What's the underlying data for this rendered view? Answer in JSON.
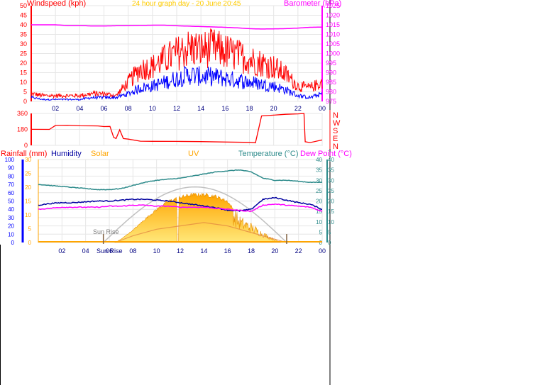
{
  "header": {
    "windspeed_label": "Windspeed (kph)",
    "title": "24 hour graph day - 20 June 20:45",
    "barometer_label": "Barometer (hPa)"
  },
  "bottom_header": {
    "rainfall_label": "Rainfall (mm)",
    "humidity_label": "Humidity",
    "solar_label": "Solar",
    "uv_label": "UV",
    "temperature_label": "Temperature (°C)",
    "dewpoint_label": "Dew Point (°C)"
  },
  "direction_labels": [
    "N",
    "W",
    "S",
    "E",
    "N"
  ],
  "sun_rise_label_top": "Sun Rise",
  "sun_rise_label_bottom": "Sun Rise",
  "colors": {
    "wind_gust": "#ff0000",
    "wind_avg": "#0000ff",
    "barometer": "#ff00ff",
    "direction": "#ff0000",
    "humidity": "#0000a0",
    "solar": "#ffa500",
    "uv_curve": "#c0c0c0",
    "temperature": "#2e8b8b",
    "dewpoint": "#ff00ff",
    "rainfall_axis": "#0000ff"
  },
  "chart_data": [
    {
      "type": "line",
      "name": "wind-barometer",
      "x_ticks": [
        "02",
        "04",
        "06",
        "08",
        "10",
        "12",
        "14",
        "16",
        "18",
        "20",
        "22",
        "00"
      ],
      "left_ticks": [
        "0",
        "5",
        "10",
        "15",
        "20",
        "25",
        "30",
        "35",
        "40",
        "45",
        "50"
      ],
      "right_ticks": [
        "975",
        "980",
        "985",
        "990",
        "995",
        "1000",
        "1005",
        "1010",
        "1015",
        "1020",
        "1025"
      ],
      "ylim_left": [
        0,
        50
      ],
      "ylim_right": [
        975,
        1025
      ],
      "hours": [
        0,
        1,
        2,
        3,
        4,
        5,
        6,
        7,
        8,
        9,
        10,
        11,
        12,
        13,
        14,
        15,
        16,
        17,
        18,
        19,
        20,
        21,
        22,
        23,
        24
      ],
      "series": [
        {
          "name": "gust",
          "values": [
            4,
            3,
            3,
            3,
            3,
            4,
            4,
            3,
            10,
            17,
            18,
            22,
            25,
            28,
            27,
            28,
            26,
            24,
            22,
            20,
            18,
            14,
            8,
            7,
            10
          ]
        },
        {
          "name": "average",
          "values": [
            2,
            1,
            1,
            1,
            1,
            2,
            2,
            2,
            4,
            7,
            8,
            10,
            12,
            14,
            13,
            13,
            12,
            11,
            10,
            9,
            8,
            6,
            3,
            2,
            4
          ]
        },
        {
          "name": "barometer",
          "values": [
            1015,
            1015,
            1015,
            1014.6,
            1014.6,
            1014.4,
            1014.4,
            1014.5,
            1014.6,
            1014.7,
            1014.8,
            1014.8,
            1014.5,
            1014.3,
            1014.1,
            1013.9,
            1013.7,
            1013.4,
            1013,
            1012.8,
            1012.9,
            1013,
            1013.3,
            1013.7,
            1013.8
          ]
        }
      ]
    },
    {
      "type": "line",
      "name": "wind-direction",
      "ylim": [
        0,
        360
      ],
      "y_ticks": [
        "0",
        "180",
        "360"
      ],
      "hours": [
        0,
        1.5,
        2,
        3,
        4,
        5,
        5.5,
        6,
        6.5,
        6.8,
        7,
        7.3,
        7.6,
        8,
        9,
        10,
        12,
        14,
        16,
        18,
        18.5,
        19,
        20,
        21,
        22,
        22.5,
        22.6,
        23,
        24
      ],
      "values": [
        180,
        180,
        225,
        225,
        220,
        220,
        218,
        215,
        215,
        90,
        75,
        175,
        80,
        70,
        50,
        45,
        42,
        40,
        38,
        35,
        30,
        330,
        340,
        350,
        355,
        360,
        40,
        30,
        60
      ]
    },
    {
      "type": "line",
      "name": "temperature-humidity",
      "x_ticks": [
        "02",
        "04",
        "06",
        "08",
        "10",
        "12",
        "14",
        "16",
        "18",
        "20",
        "22",
        "00"
      ],
      "left_ticks": [
        "0",
        "10",
        "20",
        "30",
        "40",
        "50",
        "60",
        "70",
        "80",
        "90",
        "100"
      ],
      "mid_ticks": [
        "0",
        "5",
        "10",
        "15",
        "20",
        "25",
        "30"
      ],
      "right_ticks": [
        "0",
        "5",
        "10",
        "15",
        "20",
        "25",
        "30",
        "35",
        "40"
      ],
      "ylim_left": [
        0,
        100
      ],
      "ylim_right": [
        0,
        40
      ],
      "hours": [
        0,
        1,
        2,
        3,
        4,
        5,
        6,
        7,
        8,
        9,
        10,
        11,
        12,
        13,
        14,
        15,
        16,
        17,
        18,
        19,
        20,
        21,
        22,
        23,
        24
      ],
      "series": [
        {
          "name": "temperature",
          "values": [
            28,
            27.5,
            27,
            26.5,
            26,
            25.5,
            25.5,
            26,
            27.5,
            29,
            30,
            30.5,
            31,
            32,
            33,
            34,
            34.5,
            35,
            34,
            31,
            30,
            30,
            29.5,
            29,
            29
          ]
        },
        {
          "name": "humidity",
          "values": [
            45,
            47,
            48,
            48,
            49,
            50,
            50,
            51,
            52,
            52,
            51,
            50,
            48,
            46,
            44,
            42,
            39,
            38,
            40,
            52,
            54,
            51,
            48,
            46,
            40
          ]
        },
        {
          "name": "dewpoint",
          "values": [
            16,
            16.5,
            17,
            17,
            17,
            17,
            17.5,
            17.5,
            18,
            18,
            17.5,
            17.5,
            17,
            17,
            17,
            16.5,
            16,
            15.5,
            15,
            18,
            18.5,
            18,
            17.5,
            17,
            15
          ]
        }
      ],
      "solar_hours": [
        6.5,
        7,
        8,
        9,
        10,
        11,
        12,
        13,
        14,
        15,
        16,
        17,
        18,
        19,
        20,
        20.5
      ],
      "solar_values": [
        0,
        4,
        15,
        28,
        40,
        50,
        55,
        58,
        58,
        56,
        50,
        30,
        22,
        12,
        4,
        0
      ],
      "uv_hours": [
        6.5,
        8,
        10,
        12,
        14,
        16,
        18,
        20,
        21
      ],
      "uv_values": [
        0,
        2,
        4,
        5,
        6,
        5,
        3,
        1,
        0
      ],
      "sun_rise_hour": 5.5,
      "sun_set_hour": 21
    }
  ]
}
